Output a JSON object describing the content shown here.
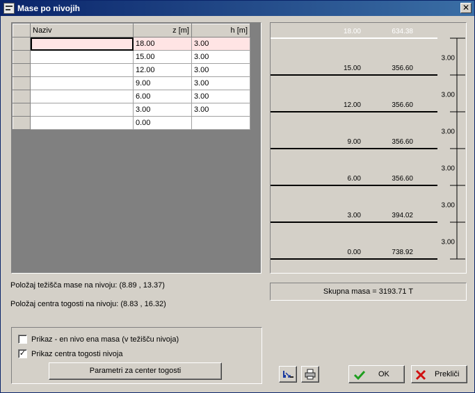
{
  "window": {
    "title": "Mase po nivojih",
    "close_glyph": "✕"
  },
  "grid": {
    "columns": [
      "Naziv",
      "z [m]",
      "h [m]"
    ],
    "rows": [
      {
        "naziv": "",
        "z": "18.00",
        "h": "3.00"
      },
      {
        "naziv": "",
        "z": "15.00",
        "h": "3.00"
      },
      {
        "naziv": "",
        "z": "12.00",
        "h": "3.00"
      },
      {
        "naziv": "",
        "z": "9.00",
        "h": "3.00"
      },
      {
        "naziv": "",
        "z": "6.00",
        "h": "3.00"
      },
      {
        "naziv": "",
        "z": "3.00",
        "h": "3.00"
      },
      {
        "naziv": "",
        "z": "0.00",
        "h": ""
      }
    ]
  },
  "info": {
    "mass_center": "Položaj težišča mase na nivoju: (8.89 , 13.37)",
    "stiffness_center": "Položaj centra togosti na nivoju: (8.83 , 16.32)"
  },
  "options": {
    "single_mass": {
      "label": "Prikaz - en nivo ena masa (v težišču nivoja)",
      "checked": false
    },
    "stiffness_center": {
      "label": "Prikaz centra togosti nivoja",
      "checked": true
    },
    "params_button": "Parametri za center togosti"
  },
  "diagram": {
    "levels": [
      {
        "z": "18.00",
        "mass": "634.38"
      },
      {
        "z": "15.00",
        "mass": "356.60"
      },
      {
        "z": "12.00",
        "mass": "356.60"
      },
      {
        "z": "9.00",
        "mass": "356.60"
      },
      {
        "z": "6.00",
        "mass": "356.60"
      },
      {
        "z": "3.00",
        "mass": "394.02"
      },
      {
        "z": "0.00",
        "mass": "738.92"
      }
    ],
    "heights": [
      "3.00",
      "3.00",
      "3.00",
      "3.00",
      "3.00",
      "3.00"
    ]
  },
  "total": "Skupna masa = 3193.71 T",
  "buttons": {
    "ok": "OK",
    "cancel": "Prekliči"
  },
  "icons": {
    "title": "app-window-icon",
    "export": "export-data-icon",
    "print": "printer-icon",
    "ok": "checkmark-icon",
    "cancel": "red-x-icon"
  },
  "colors": {
    "selected_row": "#ffe4e4",
    "ok_check": "#1e9e1e",
    "cancel_x": "#d01010",
    "top_level_text": "#ffffff"
  }
}
